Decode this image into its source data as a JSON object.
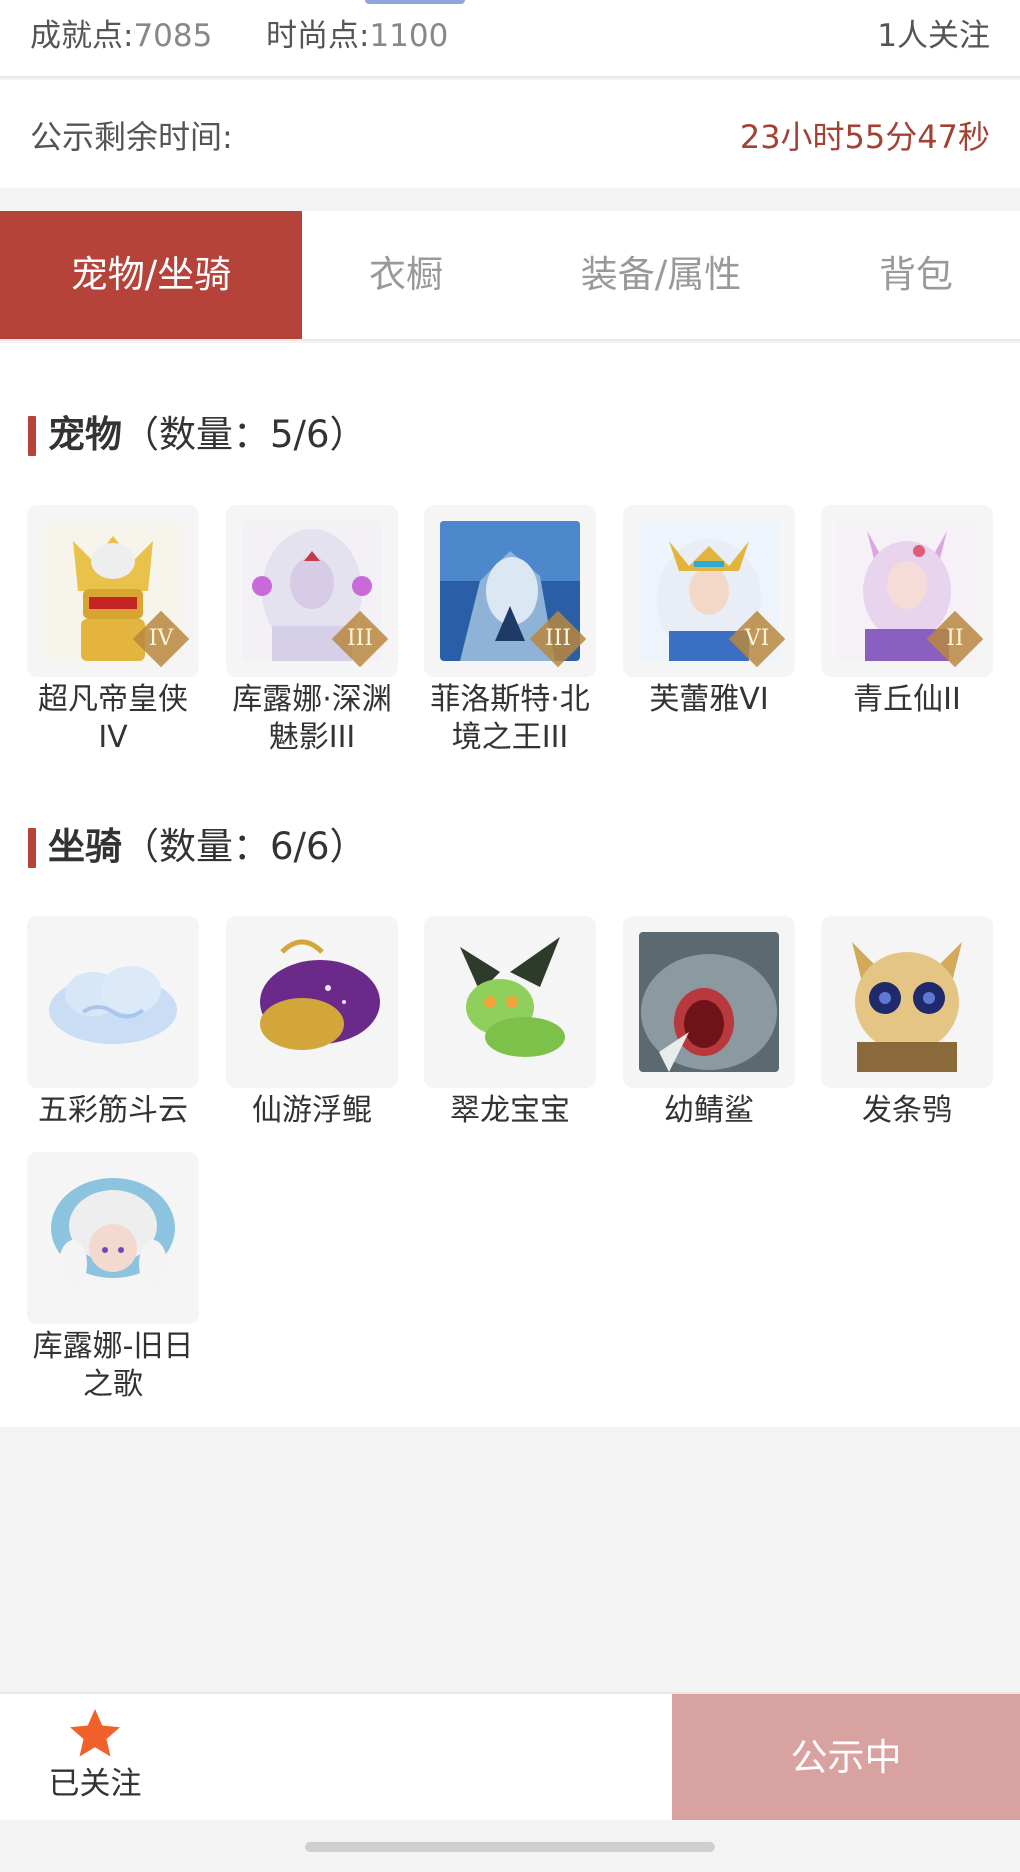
{
  "top_stats": {
    "achievement_label": "成就点:",
    "achievement_value": "7085",
    "fashion_label": "时尚点:",
    "fashion_value": "1100",
    "followers": "1人关注"
  },
  "countdown": {
    "label": "公示剩余时间:",
    "time": "23小时55分47秒",
    "time_color": "#a24134"
  },
  "tabs": [
    {
      "label": "宠物/坐骑",
      "active": true
    },
    {
      "label": "衣橱",
      "active": false
    },
    {
      "label": "装备/属性",
      "active": false
    },
    {
      "label": "背包",
      "active": false
    }
  ],
  "pets": {
    "title": "宠物",
    "count": "（数量：5/6）",
    "items": [
      {
        "name": "超凡帝皇侠IV",
        "badge": "IV",
        "icon": "golden-armored-hero-icon"
      },
      {
        "name": "库露娜·深渊魅影III",
        "badge": "III",
        "icon": "lavender-haired-girl-icon"
      },
      {
        "name": "菲洛斯特·北境之王III",
        "badge": "III",
        "icon": "ice-dragon-icon"
      },
      {
        "name": "芙蕾雅VI",
        "badge": "VI",
        "icon": "valkyrie-icon"
      },
      {
        "name": "青丘仙II",
        "badge": "II",
        "icon": "fox-spirit-icon"
      }
    ]
  },
  "mounts": {
    "title": "坐骑",
    "count": "（数量：6/6）",
    "items": [
      {
        "name": "五彩筋斗云",
        "icon": "cloud-icon"
      },
      {
        "name": "仙游浮鲲",
        "icon": "flying-whale-icon"
      },
      {
        "name": "翠龙宝宝",
        "icon": "baby-green-dragon-icon"
      },
      {
        "name": "幼鲭鲨",
        "icon": "shark-icon"
      },
      {
        "name": "发条鸮",
        "icon": "clockwork-owl-icon"
      },
      {
        "name": "库露娜-旧日之歌",
        "icon": "sheep-girl-icon"
      }
    ]
  },
  "bottom_bar": {
    "favorite_label": "已关注",
    "status_label": "公示中",
    "accent": "#b5433a",
    "star_color": "#f0612c"
  }
}
